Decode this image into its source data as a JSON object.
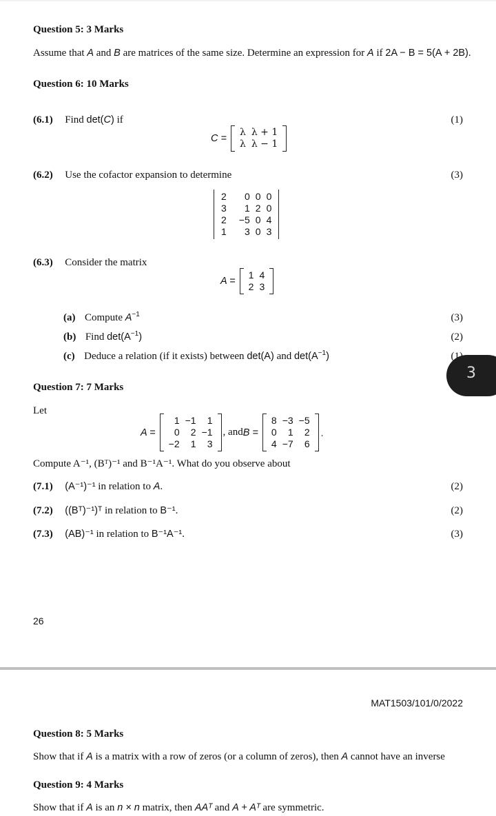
{
  "page_top": {
    "q5": {
      "title_prefix": "Question 5",
      "title_marks": ": 3 Marks",
      "text_1": "Assume that ",
      "var_A": "A",
      "text_2": " and ",
      "var_B": "B",
      "text_3": " are matrices of the same size. Determine an expression for ",
      "var_A2": "A",
      "text_4": " if ",
      "equation": "2A − B = 5(A + 2B)",
      "text_5": "."
    },
    "q6": {
      "title_prefix": "Question 6",
      "title_marks": ": 10 Marks",
      "p61": {
        "num": "(6.1)",
        "text": "Find ",
        "det": "det(",
        "var": "C",
        "close": ")",
        "text_2": " if",
        "marks": "(1)",
        "matrix_label": "C =",
        "matrix": [
          [
            "λ",
            "λ + 1"
          ],
          [
            "λ",
            "λ − 1"
          ]
        ]
      },
      "p62": {
        "num": "(6.2)",
        "text": "Use the cofactor expansion to determine",
        "marks": "(3)",
        "matrix": [
          [
            "2",
            "0",
            "0",
            "0"
          ],
          [
            "3",
            "1",
            "2",
            "0"
          ],
          [
            "2",
            "−5",
            "0",
            "4"
          ],
          [
            "1",
            "3",
            "0",
            "3"
          ]
        ]
      },
      "p63": {
        "num": "(6.3)",
        "text": "Consider the matrix",
        "matrix_label": "A =",
        "matrix": [
          [
            "1",
            "4"
          ],
          [
            "2",
            "3"
          ]
        ],
        "parts": [
          {
            "label": "(a)",
            "text": "Compute ",
            "math": "A",
            "sup": "−1",
            "tail": "",
            "marks": "(3)"
          },
          {
            "label": "(b)",
            "text": "Find ",
            "math": "det(A",
            "sup": "−1",
            "tail": ")",
            "marks": "(2)"
          },
          {
            "label": "(c)",
            "text": "Deduce a relation (if it exists) between ",
            "math": "det(A)",
            "mid": " and ",
            "math2": "det(A",
            "sup": "−1",
            "tail": ")",
            "marks": "(1)"
          }
        ]
      }
    },
    "q7": {
      "title_prefix": "Question 7",
      "title_marks": ": 7 Marks",
      "let": "Let",
      "matrix_A_label": "A =",
      "matrix_A": [
        [
          "1",
          "−1",
          "1"
        ],
        [
          "0",
          "2",
          "−1"
        ],
        [
          "−2",
          "1",
          "3"
        ]
      ],
      "and_text": ", and ",
      "matrix_B_label": "B =",
      "matrix_B": [
        [
          "8",
          "−3",
          "−5"
        ],
        [
          "0",
          "1",
          "2"
        ],
        [
          "4",
          "−7",
          "6"
        ]
      ],
      "period": ".",
      "compute_text": "Compute A⁻¹, (Bᵀ)⁻¹ and B⁻¹A⁻¹. What do you observe about",
      "parts": [
        {
          "num": "(7.1)",
          "math": "(A⁻¹)⁻¹",
          "text": " in relation to ",
          "math2": "A",
          "tail": ".",
          "marks": "(2)"
        },
        {
          "num": "(7.2)",
          "math": "((Bᵀ)⁻¹)ᵀ",
          "text": " in relation to ",
          "math2": "B⁻¹",
          "tail": ".",
          "marks": "(2)"
        },
        {
          "num": "(7.3)",
          "math": "(AB)⁻¹",
          "text": " in relation to ",
          "math2": "B⁻¹A⁻¹",
          "tail": ".",
          "marks": "(3)"
        }
      ]
    },
    "page_number": "26"
  },
  "page_bottom": {
    "header_code": "MAT1503/101/0/2022",
    "q8": {
      "title_prefix": "Question 8",
      "title_marks": ": 5 Marks",
      "text_1": "Show that if ",
      "var": "A",
      "text_2": " is a matrix with a row of zeros (or a column of zeros), then ",
      "var2": "A",
      "text_3": " cannot have an inverse"
    },
    "q9": {
      "title_prefix": "Question 9",
      "title_marks": ": 4 Marks",
      "text_1": "Show that if ",
      "var": "A",
      "text_2": " is an ",
      "math_n": "n × n",
      "text_3": " matrix, then ",
      "math_1": "AAᵀ",
      "text_4": " and ",
      "math_2": "A + Aᵀ",
      "text_5": " are symmetric."
    }
  },
  "overlay": {
    "page_badge": "3"
  }
}
